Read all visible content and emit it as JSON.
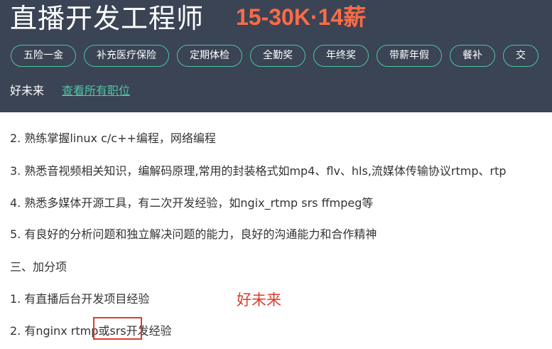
{
  "job": {
    "title": "直播开发工程师",
    "salary": "15-30K·14薪"
  },
  "benefits": [
    "五险一金",
    "补充医疗保险",
    "定期体检",
    "全勤奖",
    "年终奖",
    "带薪年假",
    "餐补",
    "交"
  ],
  "company": {
    "name": "好未来",
    "all_jobs_link": "查看所有职位"
  },
  "description": {
    "lines": [
      "2. 熟练掌握linux c/c++编程，网络编程",
      "3. 熟悉音视频相关知识，编解码原理,常用的封装格式如mp4、flv、hls,流媒体传输协议rtmp、rtp",
      "4. 熟悉多媒体开源工具，有二次开发经验，如ngix_rtmp srs ffmpeg等",
      "5. 有良好的分析问题和独立解决问题的能力，良好的沟通能力和合作精神",
      "三、加分项",
      "1. 有直播后台开发项目经验",
      "2. 有nginx rtmp或srs开发经验"
    ]
  },
  "annotation": {
    "watermark_text": "好未来",
    "color": "#e03a2e"
  },
  "colors": {
    "header_bg": "#3a4454",
    "accent": "#4fc4a5",
    "salary": "#ff6b45"
  }
}
